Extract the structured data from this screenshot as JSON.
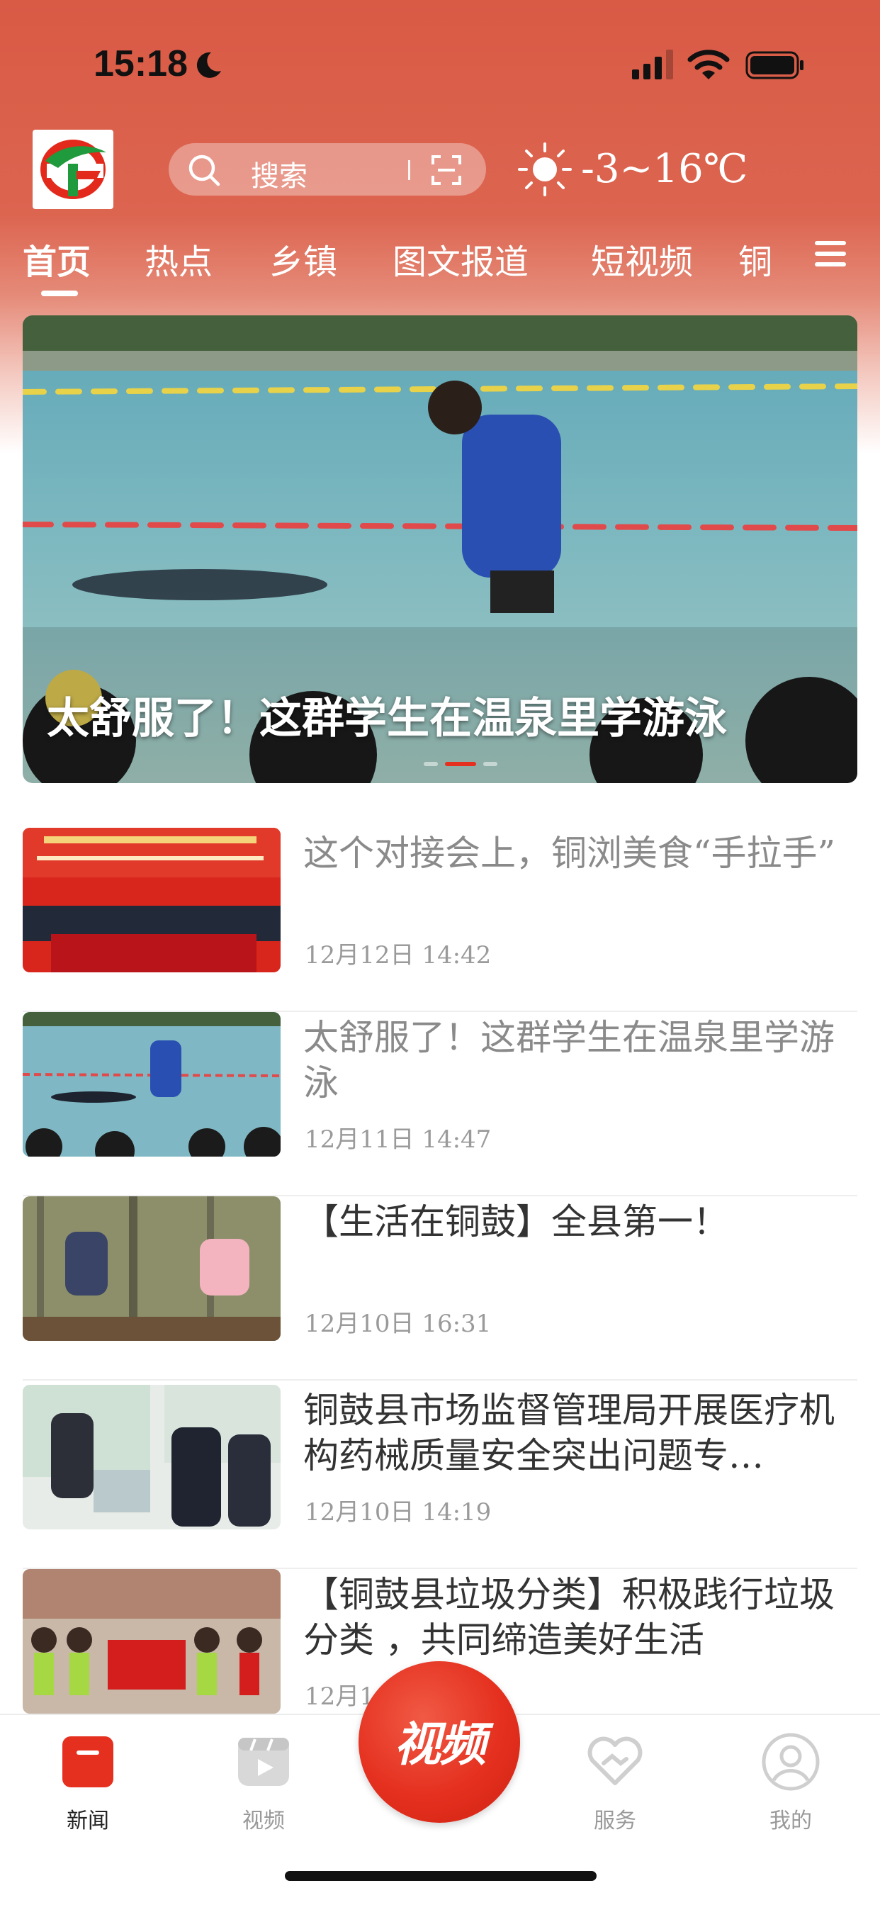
{
  "status_bar": {
    "time": "15:18"
  },
  "header": {
    "search_placeholder": "搜索",
    "weather": "-3~16℃"
  },
  "tabs": [
    "首页",
    "热点",
    "乡镇",
    "图文报道",
    "短视频",
    "铜"
  ],
  "active_tab": "首页",
  "banner": {
    "title": "太舒服了！这群学生在温泉里学游泳",
    "slide_count": 3,
    "active_slide": 2
  },
  "news": [
    {
      "title": "这个对接会上，铜浏美食“手拉手”",
      "date": "12月12日 14:42",
      "read": true
    },
    {
      "title": "太舒服了！这群学生在温泉里学游泳",
      "date": "12月11日 14:47",
      "read": true
    },
    {
      "title": "【生活在铜鼓】全县第一！",
      "date": "12月10日 16:31",
      "read": false
    },
    {
      "title": "铜鼓县市场监督管理局开展医疗机构药械质量安全突出问题专…",
      "date": "12月10日 14:19",
      "read": false
    },
    {
      "title": "【铜鼓县垃圾分类】积极践行垃圾分类 ，共同缔造美好生活",
      "date": "12月1",
      "read": false
    }
  ],
  "bottom_nav": {
    "news": "新闻",
    "video": "视频",
    "center": "视频",
    "service": "服务",
    "mine": "我的"
  },
  "colors": {
    "brand_red": "#d95a45",
    "center_button": "#e5301f"
  }
}
